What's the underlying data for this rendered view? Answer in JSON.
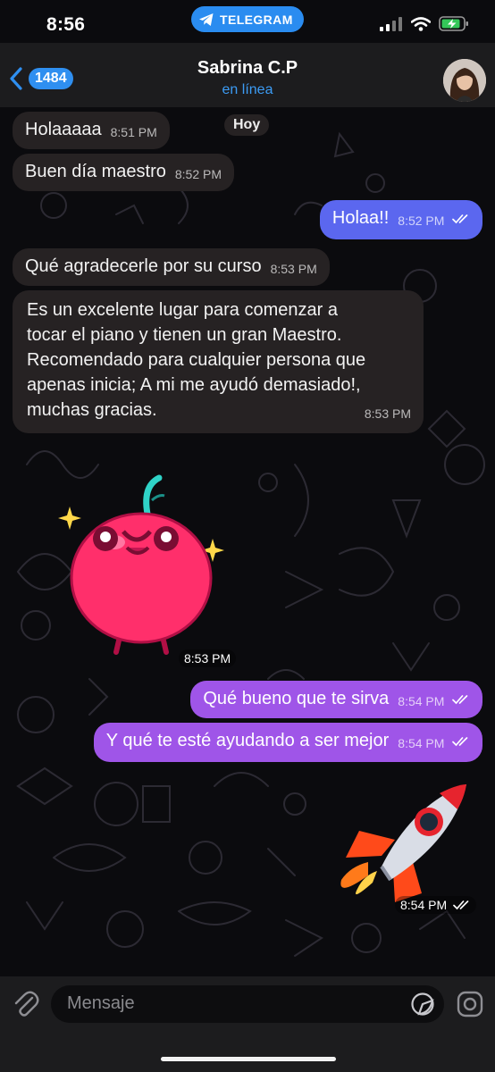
{
  "status": {
    "time": "8:56",
    "app_pill": "TELEGRAM"
  },
  "header": {
    "back_count": "1484",
    "contact_name": "Sabrina C.P",
    "contact_status": "en línea"
  },
  "date_chip": "Hoy",
  "messages": [
    {
      "text": "Holaaaaa",
      "time": "8:51 PM"
    },
    {
      "text": "Buen día maestro",
      "time": "8:52 PM"
    },
    {
      "text": "Holaa!!",
      "time": "8:52 PM"
    },
    {
      "text": "Qué agradecerle por su curso",
      "time": "8:53 PM"
    },
    {
      "lines": [
        "Es un excelente lugar para comenzar a",
        "tocar el piano y tienen un gran Maestro.",
        "Recomendado para cualquier persona que",
        "apenas inicia; A mi me ayudó demasiado!,",
        "muchas gracias."
      ],
      "time": "8:53 PM"
    },
    {
      "time": "8:53 PM"
    },
    {
      "text": "Qué bueno que te sirva",
      "time": "8:54 PM"
    },
    {
      "text": "Y qué te esté ayudando a ser mejor",
      "time": "8:54 PM"
    },
    {
      "time": "8:54 PM"
    }
  ],
  "input": {
    "placeholder": "Mensaje"
  },
  "colors": {
    "incoming_bubble": "#262223",
    "outgoing_blue": "#5b67ef",
    "outgoing_violet": "#9f55e8",
    "accent": "#2f8ff0",
    "online": "#3c9cf5"
  }
}
